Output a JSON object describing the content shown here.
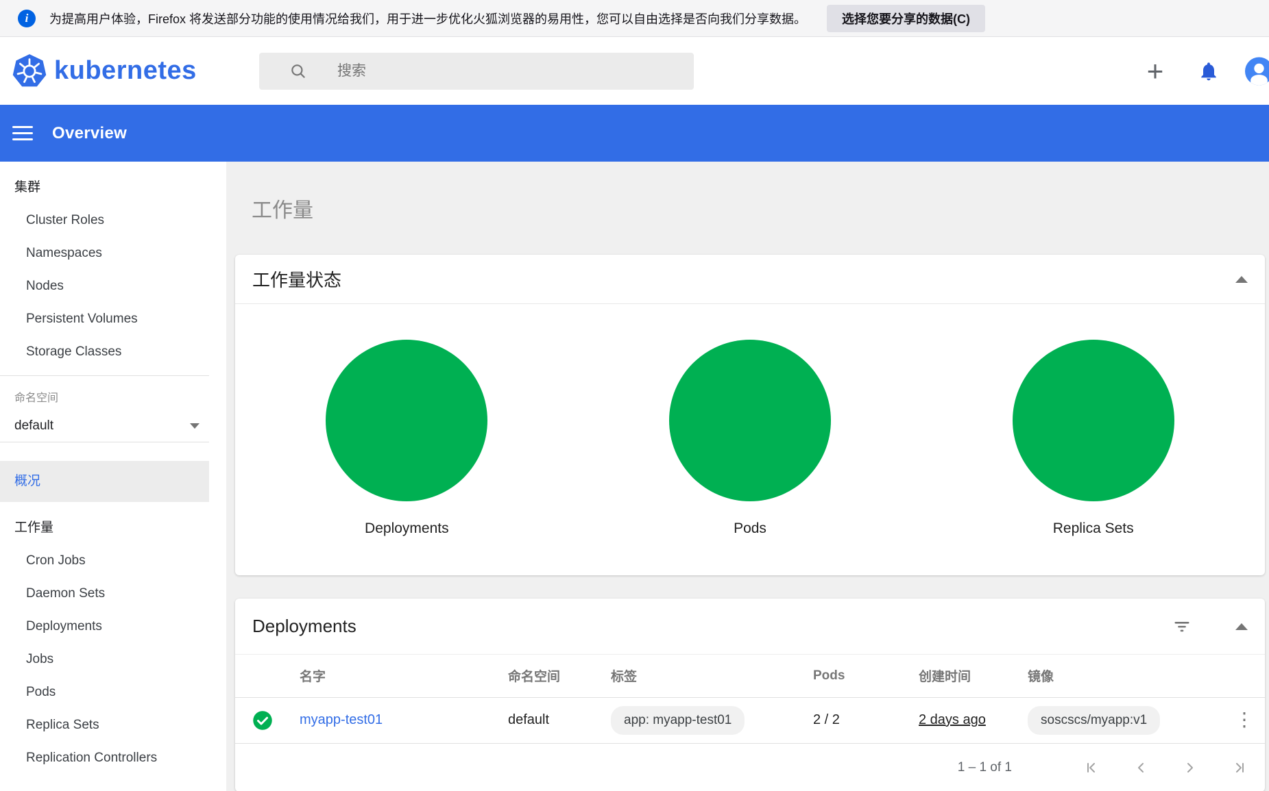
{
  "colors": {
    "brand": "#326de6",
    "success": "#00b052",
    "link": "#326de6"
  },
  "icons": {
    "plus": "+",
    "kebab": "⋮"
  },
  "notification": {
    "text": "为提高用户体验，Firefox 将发送部分功能的使用情况给我们，用于进一步优化火狐浏览器的易用性，您可以自由选择是否向我们分享数据。",
    "button": "选择您要分享的数据(C)"
  },
  "header": {
    "brand": "kubernetes",
    "search_placeholder": "搜索"
  },
  "nav": {
    "title": "Overview"
  },
  "sidebar": {
    "cluster_header": "集群",
    "cluster_items": [
      "Cluster Roles",
      "Namespaces",
      "Nodes",
      "Persistent Volumes",
      "Storage Classes"
    ],
    "namespace_label": "命名空间",
    "namespace_value": "default",
    "overview_label": "概况",
    "workload_header": "工作量",
    "workload_items": [
      "Cron Jobs",
      "Daemon Sets",
      "Deployments",
      "Jobs",
      "Pods",
      "Replica Sets",
      "Replication Controllers"
    ]
  },
  "workloads": {
    "page_title": "工作量",
    "status_card": {
      "title": "工作量状态",
      "charts": [
        {
          "label": "Deployments",
          "status": "healthy"
        },
        {
          "label": "Pods",
          "status": "healthy"
        },
        {
          "label": "Replica Sets",
          "status": "healthy"
        }
      ]
    },
    "deployments_card": {
      "title": "Deployments",
      "columns": [
        "名字",
        "命名空间",
        "标签",
        "Pods",
        "创建时间",
        "镜像"
      ],
      "rows": [
        {
          "status": "ok",
          "name": "myapp-test01",
          "namespace": "default",
          "label": "app: myapp-test01",
          "pods": "2 / 2",
          "created": "2 days ago",
          "image": "soscscs/myapp:v1"
        }
      ],
      "pagination": "1 – 1 of 1"
    }
  }
}
